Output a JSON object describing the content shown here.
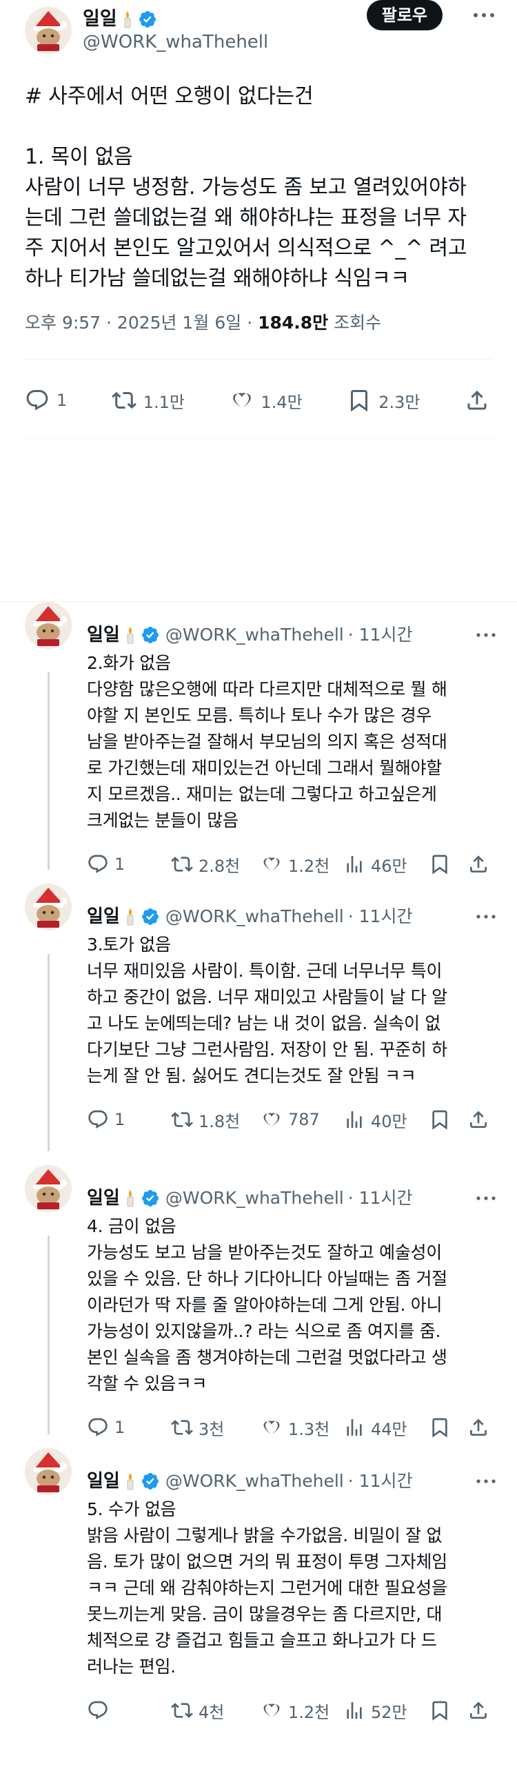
{
  "author": {
    "name": "일일",
    "handle": "@WORK_whaThehell"
  },
  "follow_label": "팔로우",
  "main_tweet": {
    "text": "# 사주에서 어떤 오행이 없다는건\n\n1. 목이 없음\n사람이 너무 냉정함. 가능성도 좀 보고 열려있어야하\n는데 그런 쓸데없는걸 왜 해야하냐는 표정을 너무 자\n주 지어서 본인도 알고있어서 의식적으로 ^_^ 려고\n하나 티가남 쓸데없는걸 왜해야하냐 식임ㅋㅋ",
    "time": "오후 9:57 · 2025년 1월 6일 · ",
    "views": "184.8만",
    "views_label": " 조회수",
    "stats": {
      "replies": "1",
      "retweets": "1.1만",
      "likes": "1.4만",
      "bookmarks": "2.3만"
    }
  },
  "replies": [
    {
      "time": "· 11시간",
      "text": "2.화가 없음\n다양함 많은오행에 따라 다르지만 대체적으로 뭘 해\n야할 지 본인도 모름. 특히나 토나 수가 많은 경우\n남을 받아주는걸 잘해서 부모님의 의지 혹은 성적대\n로 가긴했는데 재미있는건 아닌데 그래서 뭘해야할\n지 모르겠음.. 재미는 없는데 그렇다고 하고싶은게\n크게없는 분들이 많음",
      "stats": {
        "replies": "1",
        "retweets": "2.8천",
        "likes": "1.2천",
        "views": "46만"
      }
    },
    {
      "time": "· 11시간",
      "text": "3.토가 없음\n너무 재미있음 사람이. 특이함. 근데 너무너무 특이\n하고 중간이 없음. 너무 재미있고 사람들이 날 다 알\n고 나도 눈에띄는데? 남는 내 것이 없음. 실속이 없\n다기보단 그냥 그런사람임. 저장이 안 됨. 꾸준히 하\n는게 잘 안 됨. 싫어도 견디는것도 잘 안됨 ㅋㅋ",
      "stats": {
        "replies": "1",
        "retweets": "1.8천",
        "likes": "787",
        "views": "40만"
      }
    },
    {
      "time": "· 11시간",
      "text": "4. 금이 없음\n가능성도 보고 남을 받아주는것도 잘하고 예술성이\n있을 수 있음. 단 하나 기다아니다 아닐때는 좀 거절\n이라던가 딱 자를 줄 알아야하는데 그게 안됨. 아니\n가능성이 있지않을까..? 라는 식으로 좀 여지를 줌.\n본인 실속을 좀 챙겨야하는데 그런걸 멋없다라고 생\n각할 수 있음ㅋㅋ",
      "stats": {
        "replies": "1",
        "retweets": "3천",
        "likes": "1.3천",
        "views": "44만"
      }
    },
    {
      "time": "· 11시간",
      "text": "5. 수가 없음\n밝음 사람이 그렇게나 밝을 수가없음. 비밀이 잘 없\n음. 토가 많이 없으면 거의 뭐 표정이 투명 그자체임\nㅋㅋ 근데 왜 감춰야하는지 그런거에 대한 필요성을\n못느끼는게 맞음. 금이 많을경우는 좀 다르지만, 대\n체적으로 걍 즐겁고 힘들고 슬프고 화나고가 다 드\n러나는 편임.",
      "stats": {
        "replies": "",
        "retweets": "4천",
        "likes": "1.2천",
        "views": "52만"
      }
    }
  ],
  "icons": {
    "verified": "verified-badge-icon",
    "candle": "candle-emoji-icon",
    "reply": "reply-icon",
    "retweet": "retweet-icon",
    "like": "heart-icon",
    "views": "views-icon",
    "bookmark": "bookmark-icon",
    "share": "share-icon",
    "more": "more-icon"
  },
  "colors": {
    "verified": "#1d9bf0",
    "muted": "#536471",
    "text": "#0f1419",
    "thread_line": "#cfd9de"
  }
}
